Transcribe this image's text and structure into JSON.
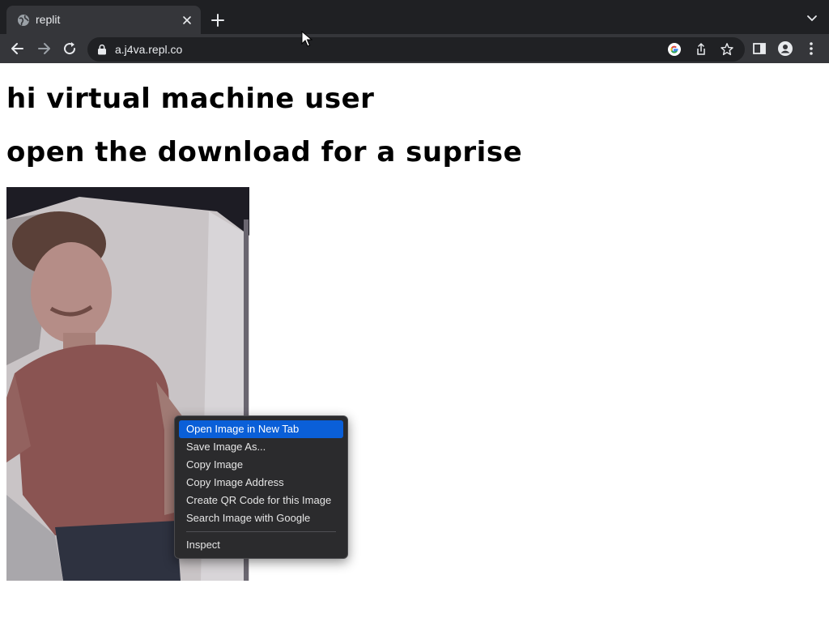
{
  "browser": {
    "tab": {
      "title": "replit",
      "favicon": "globe-icon"
    },
    "address_bar": {
      "url": "a.j4va.repl.co",
      "security_icon": "lock-icon"
    },
    "toolbar_icons": [
      "back-icon",
      "forward-icon",
      "reload-icon",
      "google-icon",
      "share-icon",
      "bookmark-star-icon",
      "side-panel-icon",
      "profile-icon",
      "menu-icon"
    ]
  },
  "page": {
    "heading1": "hi virtual machine user",
    "heading2": "open the download for a suprise"
  },
  "context_menu": {
    "items": [
      {
        "label": "Open Image in New Tab"
      },
      {
        "label": "Save Image As..."
      },
      {
        "label": "Copy Image"
      },
      {
        "label": "Copy Image Address"
      },
      {
        "label": "Create QR Code for this Image"
      },
      {
        "label": "Search Image with Google"
      },
      {
        "label": "Inspect"
      }
    ],
    "highlighted": "Open Image in New Tab"
  },
  "colors": {
    "tabstrip_bg": "#1f2023",
    "toolbar_bg": "#35363a",
    "menu_highlight": "#0a5fd8"
  }
}
